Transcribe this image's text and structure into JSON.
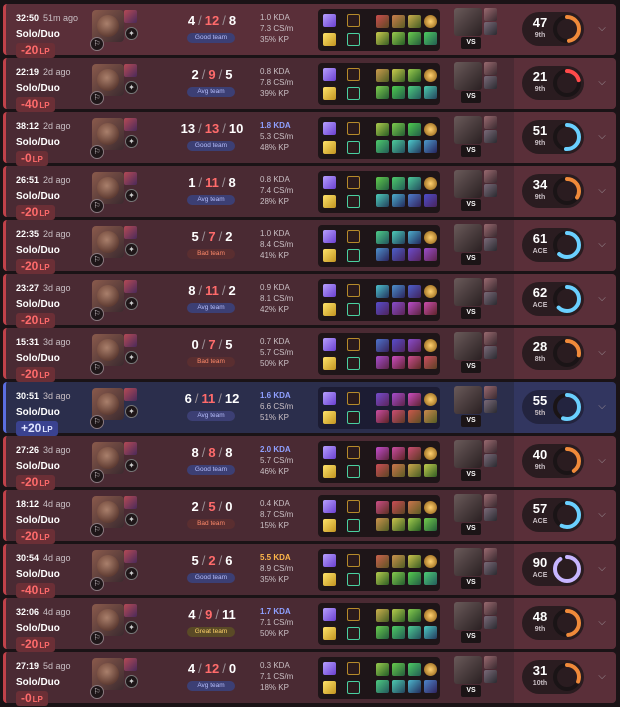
{
  "matches": [
    {
      "time": "32:50",
      "ago": "51m ago",
      "queue": "Solo/Duo",
      "lp": "-20",
      "kills": "4",
      "deaths": "12",
      "assists": "8",
      "team": "Good team",
      "kda": "1.0 KDA",
      "cs": "7.3 CS/m",
      "kp": "35% KP",
      "score": "47",
      "rank": "9th",
      "result": "lose",
      "ring": 0.47,
      "ringColor": "#f08a3a"
    },
    {
      "time": "22:19",
      "ago": "2d ago",
      "queue": "Solo/Duo",
      "lp": "-40",
      "kills": "2",
      "deaths": "9",
      "assists": "5",
      "team": "Avg team",
      "kda": "0.8 KDA",
      "cs": "7.8 CS/m",
      "kp": "39% KP",
      "score": "21",
      "rank": "9th",
      "result": "lose",
      "ring": 0.21,
      "ringColor": "#ff4a4a"
    },
    {
      "time": "38:12",
      "ago": "2d ago",
      "queue": "Solo/Duo",
      "lp": "-0",
      "kills": "13",
      "deaths": "13",
      "assists": "10",
      "team": "Good team",
      "kda": "1.8 KDA",
      "cs": "5.3 CS/m",
      "kp": "48% KP",
      "score": "51",
      "rank": "9th",
      "result": "lose",
      "ring": 0.51,
      "ringColor": "#6ad0ff"
    },
    {
      "time": "26:51",
      "ago": "2d ago",
      "queue": "Solo/Duo",
      "lp": "-20",
      "kills": "1",
      "deaths": "11",
      "assists": "8",
      "team": "Avg team",
      "kda": "0.8 KDA",
      "cs": "7.4 CS/m",
      "kp": "28% KP",
      "score": "34",
      "rank": "9th",
      "result": "lose",
      "ring": 0.34,
      "ringColor": "#f08a3a"
    },
    {
      "time": "22:35",
      "ago": "2d ago",
      "queue": "Solo/Duo",
      "lp": "-20",
      "kills": "5",
      "deaths": "7",
      "assists": "2",
      "team": "Bad team",
      "kda": "1.0 KDA",
      "cs": "8.4 CS/m",
      "kp": "41% KP",
      "score": "61",
      "rank": "ACE",
      "result": "lose",
      "ring": 0.61,
      "ringColor": "#6ad0ff"
    },
    {
      "time": "23:27",
      "ago": "3d ago",
      "queue": "Solo/Duo",
      "lp": "-20",
      "kills": "8",
      "deaths": "11",
      "assists": "2",
      "team": "Avg team",
      "kda": "0.9 KDA",
      "cs": "8.1 CS/m",
      "kp": "42% KP",
      "score": "62",
      "rank": "ACE",
      "result": "lose",
      "ring": 0.62,
      "ringColor": "#6ad0ff"
    },
    {
      "time": "15:31",
      "ago": "3d ago",
      "queue": "Solo/Duo",
      "lp": "-20",
      "kills": "0",
      "deaths": "7",
      "assists": "5",
      "team": "Bad team",
      "kda": "0.7 KDA",
      "cs": "5.7 CS/m",
      "kp": "50% KP",
      "score": "28",
      "rank": "8th",
      "result": "lose",
      "ring": 0.28,
      "ringColor": "#f08a3a"
    },
    {
      "time": "30:51",
      "ago": "3d ago",
      "queue": "Solo/Duo",
      "lp": "+20",
      "kills": "6",
      "deaths": "11",
      "assists": "12",
      "team": "Avg team",
      "kda": "1.6 KDA",
      "cs": "6.6 CS/m",
      "kp": "51% KP",
      "score": "55",
      "rank": "5th",
      "result": "win",
      "ring": 0.55,
      "ringColor": "#6ad0ff"
    },
    {
      "time": "27:26",
      "ago": "3d ago",
      "queue": "Solo/Duo",
      "lp": "-20",
      "kills": "8",
      "deaths": "8",
      "assists": "8",
      "team": "Good team",
      "kda": "2.0 KDA",
      "cs": "5.7 CS/m",
      "kp": "46% KP",
      "score": "40",
      "rank": "9th",
      "result": "lose",
      "ring": 0.4,
      "ringColor": "#f08a3a"
    },
    {
      "time": "18:12",
      "ago": "4d ago",
      "queue": "Solo/Duo",
      "lp": "-20",
      "kills": "2",
      "deaths": "5",
      "assists": "0",
      "team": "Bad team",
      "kda": "0.4 KDA",
      "cs": "8.7 CS/m",
      "kp": "15% KP",
      "score": "57",
      "rank": "ACE",
      "result": "lose",
      "ring": 0.57,
      "ringColor": "#6ad0ff"
    },
    {
      "time": "30:54",
      "ago": "4d ago",
      "queue": "Solo/Duo",
      "lp": "-40",
      "kills": "5",
      "deaths": "2",
      "assists": "6",
      "team": "Good team",
      "kda": "5.5 KDA",
      "cs": "8.9 CS/m",
      "kp": "35% KP",
      "score": "90",
      "rank": "ACE",
      "result": "lose",
      "ring": 0.9,
      "ringColor": "#c7b5ff"
    },
    {
      "time": "32:06",
      "ago": "4d ago",
      "queue": "Solo/Duo",
      "lp": "-20",
      "kills": "4",
      "deaths": "9",
      "assists": "11",
      "team": "Great team",
      "kda": "1.7 KDA",
      "cs": "7.1 CS/m",
      "kp": "50% KP",
      "score": "48",
      "rank": "9th",
      "result": "lose",
      "ring": 0.48,
      "ringColor": "#f08a3a"
    },
    {
      "time": "27:19",
      "ago": "5d ago",
      "queue": "Solo/Duo",
      "lp": "-0",
      "kills": "4",
      "deaths": "12",
      "assists": "0",
      "team": "Avg team",
      "kda": "0.3 KDA",
      "cs": "7.1 CS/m",
      "kp": "18% KP",
      "score": "31",
      "rank": "10th",
      "result": "lose",
      "ring": 0.31,
      "ringColor": "#f08a3a"
    }
  ],
  "labels": {
    "lp_unit": "LP",
    "vs": "VS"
  },
  "icons": {
    "expand": "chevron-down-icon",
    "role": "role-icon",
    "rune": "rune-icon"
  }
}
